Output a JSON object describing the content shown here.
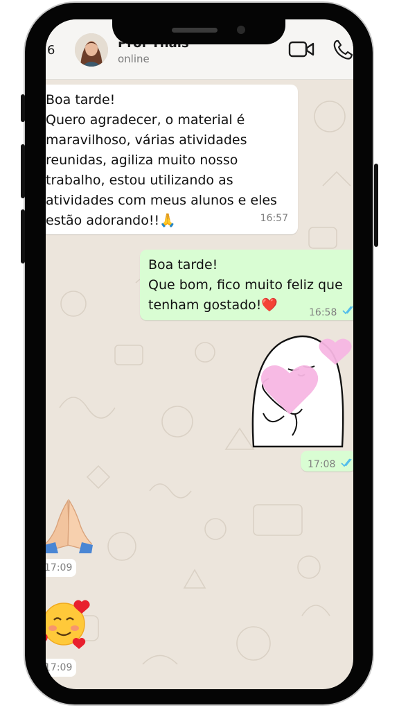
{
  "header": {
    "back_count": "6",
    "contact_name": "Prof Thaís",
    "status": "online"
  },
  "messages": [
    {
      "direction": "in",
      "text": "Boa tarde!\nQuero agradecer, o material é maravilhoso, várias atividades reunidas, agiliza muito nosso trabalho, estou utilizando as atividades com meus alunos e eles estão adorando!!🙏",
      "time": "16:57"
    },
    {
      "direction": "out",
      "text": "Boa tarde!\nQue bom, fico muito feliz que tenham gostado!❤️",
      "time": "16:58",
      "status": "read"
    },
    {
      "direction": "out",
      "type": "sticker",
      "sticker": "shy-blob-with-hearts",
      "time": "17:08",
      "status": "read"
    },
    {
      "direction": "in",
      "type": "emoji",
      "emoji": "🙏",
      "time": "17:09"
    },
    {
      "direction": "in",
      "type": "emoji",
      "emoji": "🥰",
      "time": "17:09"
    }
  ],
  "colors": {
    "incoming_bubble": "#ffffff",
    "outgoing_bubble": "#d9fdd3",
    "read_ticks": "#53bdeb",
    "chat_background": "#ece5dc"
  }
}
